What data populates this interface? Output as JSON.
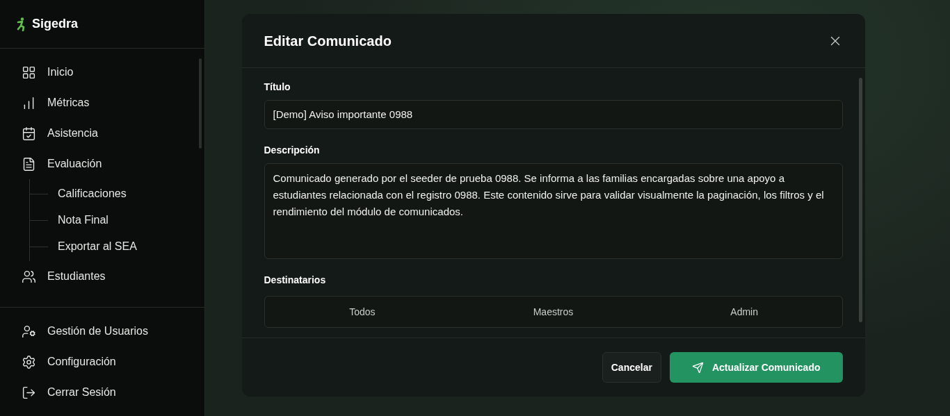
{
  "sidebar": {
    "brand": "Sigedra",
    "items": [
      {
        "label": "Inicio"
      },
      {
        "label": "Métricas"
      },
      {
        "label": "Asistencia"
      },
      {
        "label": "Evaluación",
        "expanded": true,
        "children": [
          {
            "label": "Calificaciones"
          },
          {
            "label": "Nota Final"
          },
          {
            "label": "Exportar al SEA"
          }
        ]
      },
      {
        "label": "Estudiantes"
      }
    ],
    "footer_items": [
      {
        "label": "Gestión de Usuarios"
      },
      {
        "label": "Configuración"
      },
      {
        "label": "Cerrar Sesión"
      }
    ]
  },
  "dialog": {
    "title": "Editar Comunicado",
    "fields": [
      {
        "label": "Título",
        "kind": "input",
        "value": "[Demo] Aviso importante 0988"
      },
      {
        "label": "Descripción",
        "kind": "textarea",
        "value": "Comunicado generado por el seeder de prueba 0988. Se informa a las familias encargadas sobre una apoyo a estudiantes relacionada con el registro 0988. Este contenido sirve para validar visualmente la paginación, los filtros y el rendimiento del módulo de comunicados."
      }
    ],
    "recipients": {
      "label": "Destinatarios",
      "options": [
        "Todos",
        "Maestros",
        "Admin"
      ]
    },
    "buttons": [
      {
        "label": "Cancelar",
        "kind": "secondary"
      },
      {
        "label": "Actualizar Comunicado",
        "kind": "primary"
      }
    ]
  }
}
